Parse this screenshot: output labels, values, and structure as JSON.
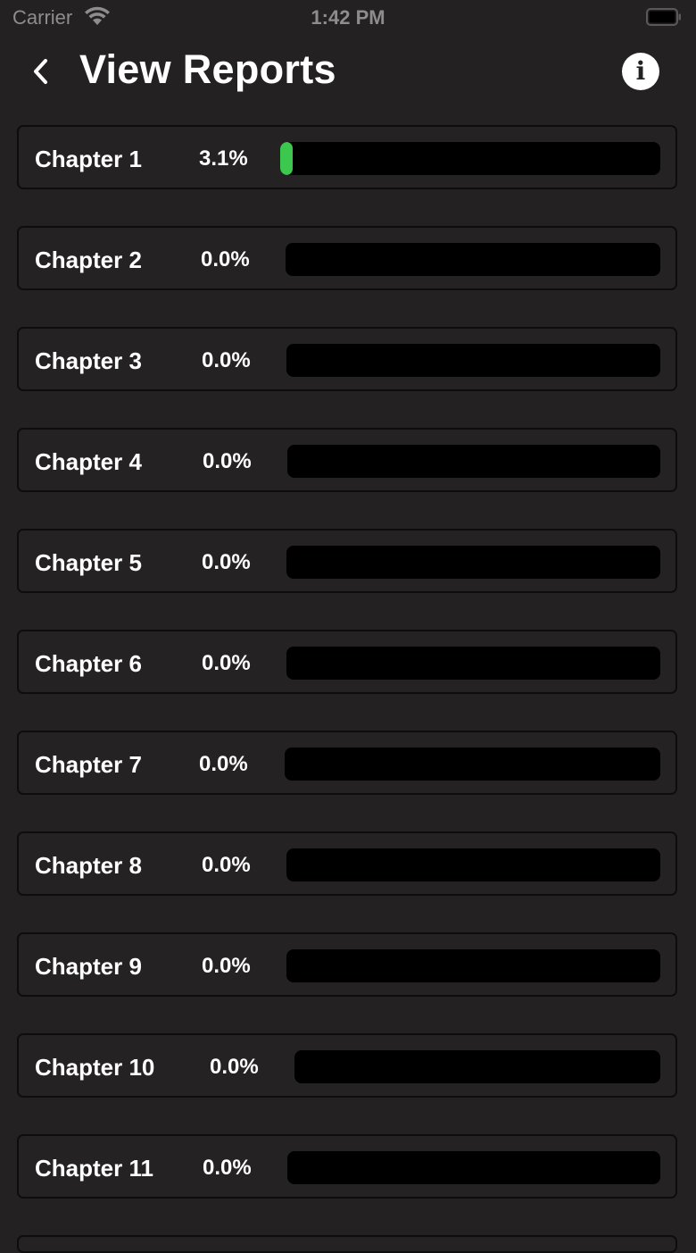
{
  "status_bar": {
    "carrier": "Carrier",
    "time": "1:42 PM"
  },
  "header": {
    "title": "View Reports",
    "back_icon": "chevron-left-icon",
    "info_icon": "info-icon",
    "info_glyph": "i"
  },
  "colors": {
    "background": "#232122",
    "progress_fill": "#3cc84e",
    "track": "#000000"
  },
  "chapters": [
    {
      "label": "Chapter 1",
      "percent": "3.1%",
      "progress": 0.031
    },
    {
      "label": "Chapter 2",
      "percent": "0.0%",
      "progress": 0.0
    },
    {
      "label": "Chapter 3",
      "percent": "0.0%",
      "progress": 0.0
    },
    {
      "label": "Chapter 4",
      "percent": "0.0%",
      "progress": 0.0
    },
    {
      "label": "Chapter 5",
      "percent": "0.0%",
      "progress": 0.0
    },
    {
      "label": "Chapter 6",
      "percent": "0.0%",
      "progress": 0.0
    },
    {
      "label": "Chapter 7",
      "percent": "0.0%",
      "progress": 0.0
    },
    {
      "label": "Chapter 8",
      "percent": "0.0%",
      "progress": 0.0
    },
    {
      "label": "Chapter 9",
      "percent": "0.0%",
      "progress": 0.0
    },
    {
      "label": "Chapter 10",
      "percent": "0.0%",
      "progress": 0.0
    },
    {
      "label": "Chapter 11",
      "percent": "0.0%",
      "progress": 0.0
    }
  ]
}
